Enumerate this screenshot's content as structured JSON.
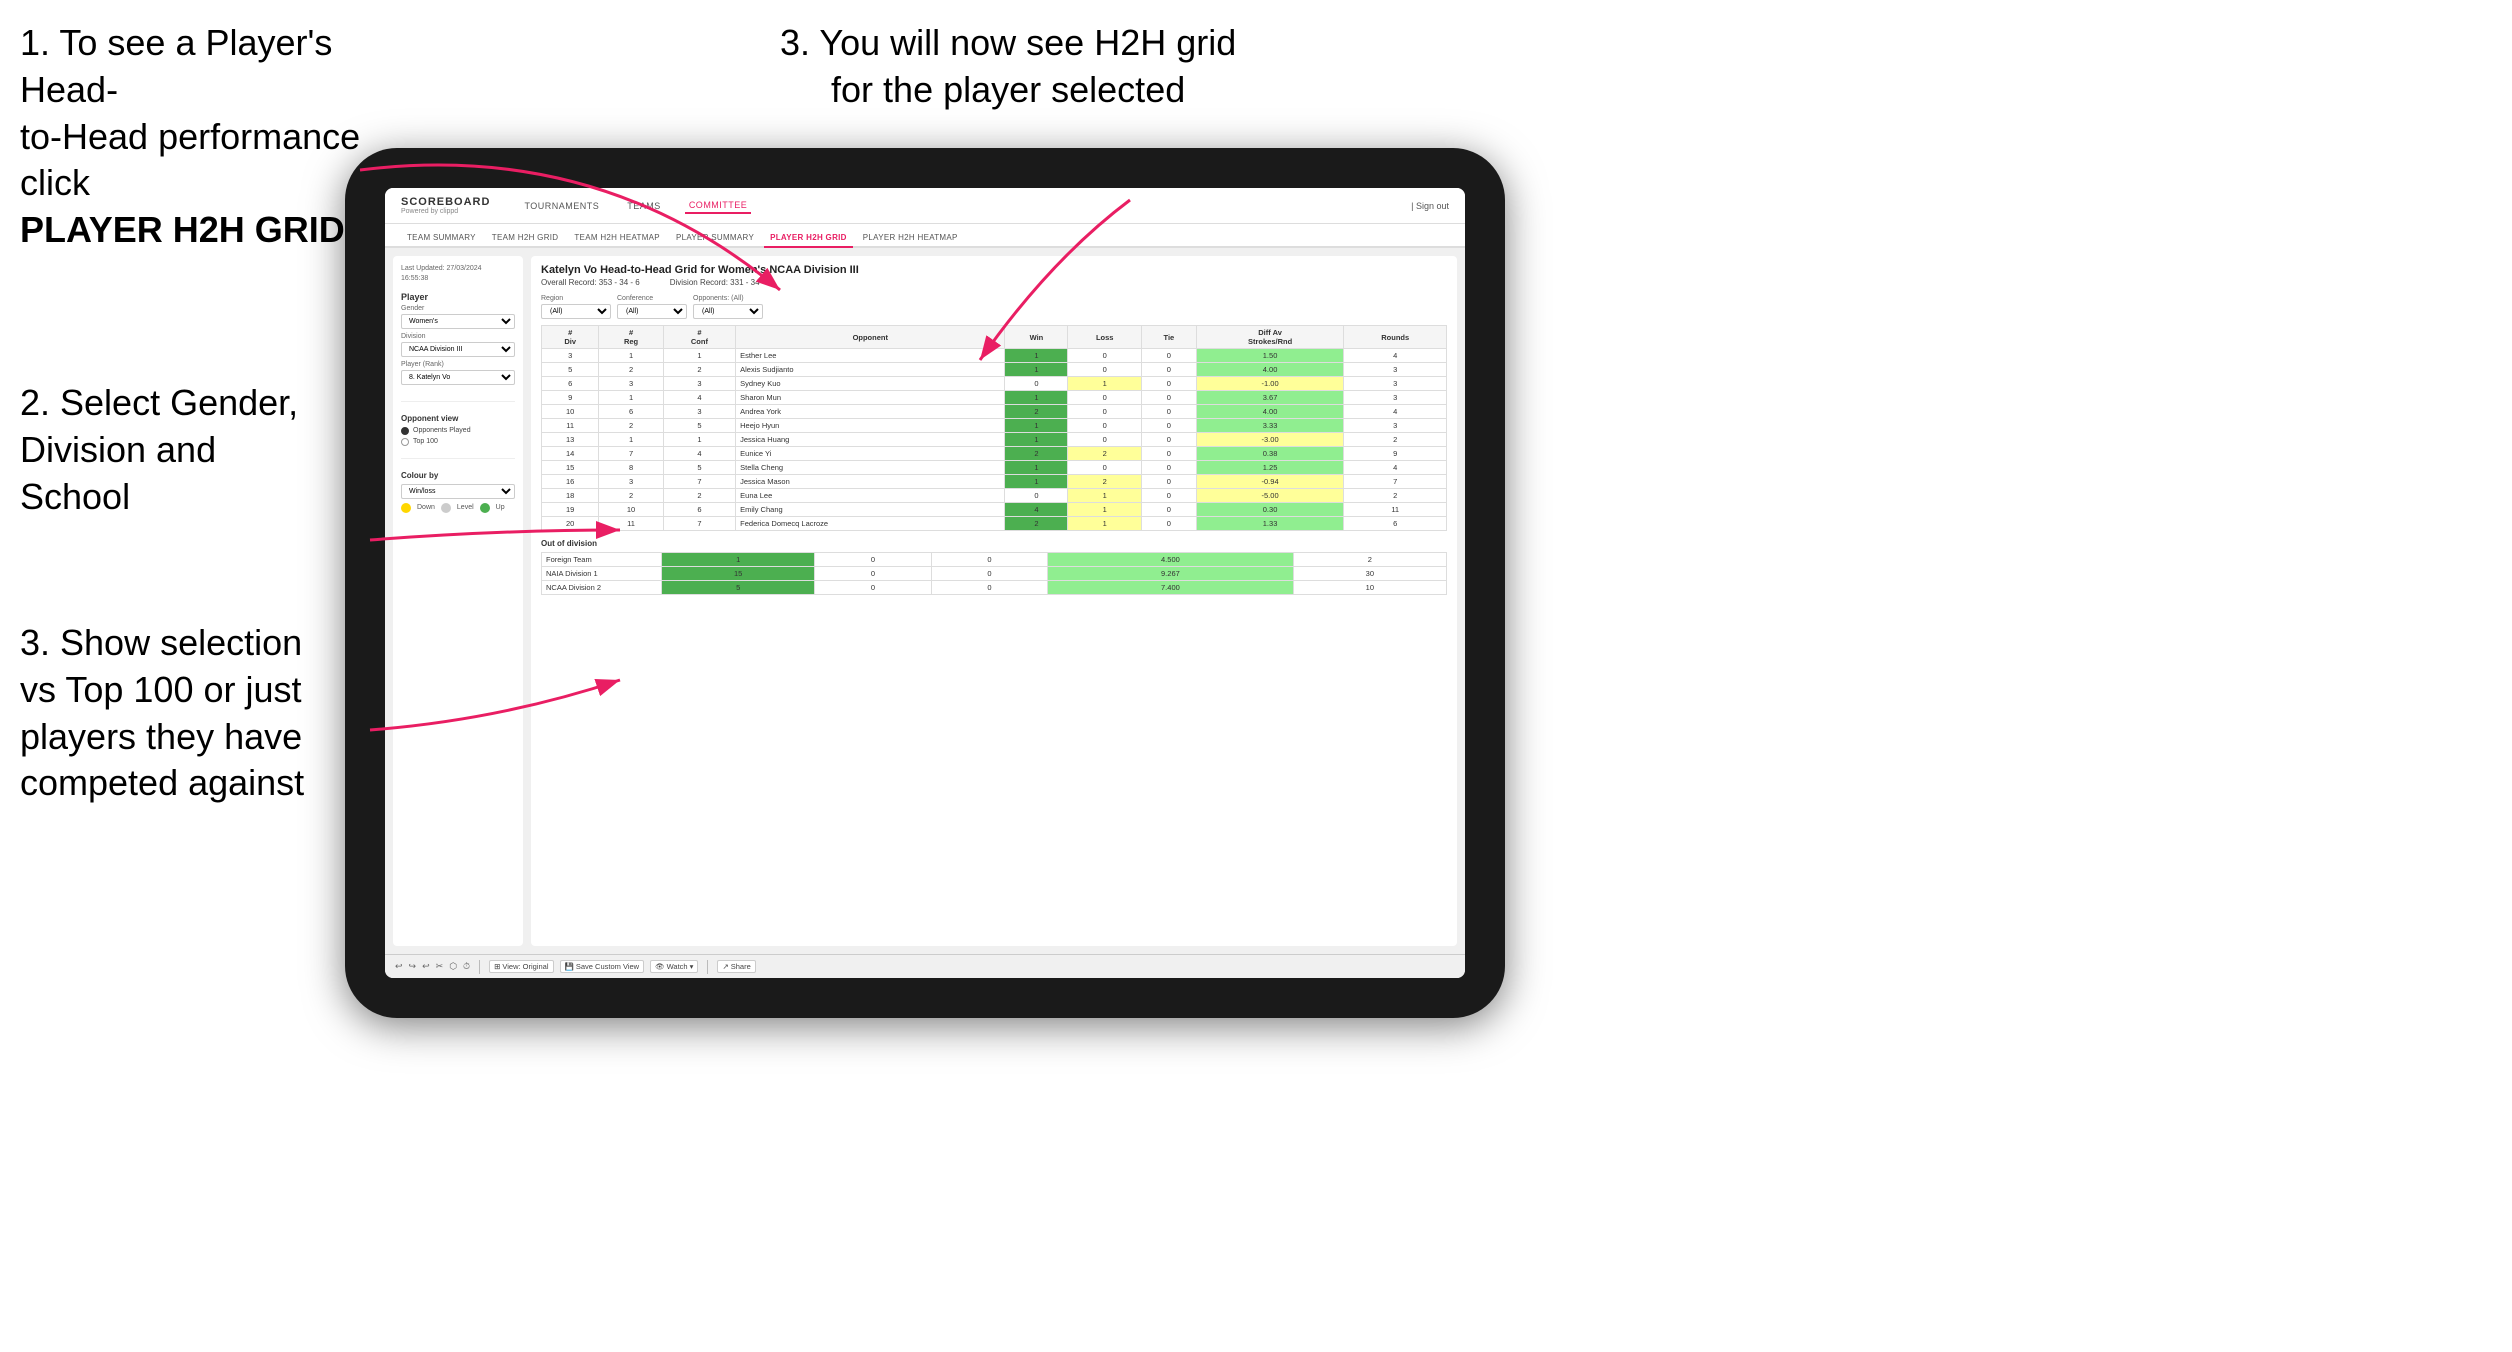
{
  "instructions": {
    "top_left_1": "1. To see a Player's Head-",
    "top_left_2": "to-Head performance click",
    "top_left_bold": "PLAYER H2H GRID",
    "top_right": "3. You will now see H2H grid\nfor the player selected",
    "mid_left_title": "2. Select Gender,\nDivision and\nSchool",
    "bot_left_title": "3. Show selection\nvs Top 100 or just\nplayers they have\ncompeted against"
  },
  "nav": {
    "logo": "SCOREBOARD",
    "logo_sub": "Powered by clippd",
    "items": [
      "TOURNAMENTS",
      "TEAMS",
      "COMMITTEE"
    ],
    "sign_out": "Sign out"
  },
  "sub_nav": {
    "items": [
      "TEAM SUMMARY",
      "TEAM H2H GRID",
      "TEAM H2H HEATMAP",
      "PLAYER SUMMARY",
      "PLAYER H2H GRID",
      "PLAYER H2H HEATMAP"
    ],
    "active": "PLAYER H2H GRID"
  },
  "sidebar": {
    "timestamp": "Last Updated: 27/03/2024\n16:55:38",
    "player_section": "Player",
    "gender_label": "Gender",
    "gender_value": "Women's",
    "division_label": "Division",
    "division_value": "NCAA Division III",
    "player_rank_label": "Player (Rank)",
    "player_rank_value": "8. Katelyn Vo",
    "opponent_view": "Opponent view",
    "opponent_options": [
      "Opponents Played",
      "Top 100"
    ],
    "opponent_selected": "Opponents Played",
    "colour_by": "Colour by",
    "colour_value": "Win/loss",
    "legend": [
      {
        "color": "#FFD700",
        "label": "Down"
      },
      {
        "color": "#cccccc",
        "label": "Level"
      },
      {
        "color": "#4CAF50",
        "label": "Up"
      }
    ]
  },
  "panel": {
    "title": "Katelyn Vo Head-to-Head Grid for Women's NCAA Division III",
    "overall_record": "Overall Record: 353 - 34 - 6",
    "division_record": "Division Record: 331 - 34 - 6",
    "filters": {
      "opponents_label": "Opponents:",
      "region_label": "Region",
      "conference_label": "Conference",
      "opponent_label": "Opponent",
      "all_value": "(All)"
    },
    "table_headers": [
      "# Div",
      "# Reg",
      "# Conf",
      "Opponent",
      "Win",
      "Loss",
      "Tie",
      "Diff Av Strokes/Rnd",
      "Rounds"
    ],
    "rows": [
      {
        "div": 3,
        "reg": 1,
        "conf": 1,
        "opponent": "Esther Lee",
        "win": 1,
        "loss": 0,
        "tie": 0,
        "diff": 1.5,
        "rounds": 4,
        "color": "green"
      },
      {
        "div": 5,
        "reg": 2,
        "conf": 2,
        "opponent": "Alexis Sudjianto",
        "win": 1,
        "loss": 0,
        "tie": 0,
        "diff": 4.0,
        "rounds": 3,
        "color": "green"
      },
      {
        "div": 6,
        "reg": 3,
        "conf": 3,
        "opponent": "Sydney Kuo",
        "win": 0,
        "loss": 1,
        "tie": 0,
        "diff": -1.0,
        "rounds": 3,
        "color": "yellow"
      },
      {
        "div": 9,
        "reg": 1,
        "conf": 4,
        "opponent": "Sharon Mun",
        "win": 1,
        "loss": 0,
        "tie": 0,
        "diff": 3.67,
        "rounds": 3,
        "color": "green"
      },
      {
        "div": 10,
        "reg": 6,
        "conf": 3,
        "opponent": "Andrea York",
        "win": 2,
        "loss": 0,
        "tie": 0,
        "diff": 4.0,
        "rounds": 4,
        "color": "green"
      },
      {
        "div": 11,
        "reg": 2,
        "conf": 5,
        "opponent": "Heejo Hyun",
        "win": 1,
        "loss": 0,
        "tie": 0,
        "diff": 3.33,
        "rounds": 3,
        "color": "green"
      },
      {
        "div": 13,
        "reg": 1,
        "conf": 1,
        "opponent": "Jessica Huang",
        "win": 1,
        "loss": 0,
        "tie": 0,
        "diff": -3.0,
        "rounds": 2,
        "color": "yellow"
      },
      {
        "div": 14,
        "reg": 7,
        "conf": 4,
        "opponent": "Eunice Yi",
        "win": 2,
        "loss": 2,
        "tie": 0,
        "diff": 0.38,
        "rounds": 9,
        "color": "light-green"
      },
      {
        "div": 15,
        "reg": 8,
        "conf": 5,
        "opponent": "Stella Cheng",
        "win": 1,
        "loss": 0,
        "tie": 0,
        "diff": 1.25,
        "rounds": 4,
        "color": "green"
      },
      {
        "div": 16,
        "reg": 3,
        "conf": 7,
        "opponent": "Jessica Mason",
        "win": 1,
        "loss": 2,
        "tie": 0,
        "diff": -0.94,
        "rounds": 7,
        "color": "yellow"
      },
      {
        "div": 18,
        "reg": 2,
        "conf": 2,
        "opponent": "Euna Lee",
        "win": 0,
        "loss": 1,
        "tie": 0,
        "diff": -5.0,
        "rounds": 2,
        "color": "yellow"
      },
      {
        "div": 19,
        "reg": 10,
        "conf": 6,
        "opponent": "Emily Chang",
        "win": 4,
        "loss": 1,
        "tie": 0,
        "diff": 0.3,
        "rounds": 11,
        "color": "light-green"
      },
      {
        "div": 20,
        "reg": 11,
        "conf": 7,
        "opponent": "Federica Domecq Lacroze",
        "win": 2,
        "loss": 1,
        "tie": 0,
        "diff": 1.33,
        "rounds": 6,
        "color": "light-green"
      }
    ],
    "out_of_division": "Out of division",
    "ood_rows": [
      {
        "label": "Foreign Team",
        "win": 1,
        "loss": 0,
        "tie": 0,
        "diff": 4.5,
        "rounds": 2
      },
      {
        "label": "NAIA Division 1",
        "win": 15,
        "loss": 0,
        "tie": 0,
        "diff": 9.267,
        "rounds": 30
      },
      {
        "label": "NCAA Division 2",
        "win": 5,
        "loss": 0,
        "tie": 0,
        "diff": 7.4,
        "rounds": 10
      }
    ]
  },
  "toolbar": {
    "buttons": [
      "View: Original",
      "Save Custom View",
      "Watch",
      "Share"
    ]
  },
  "colors": {
    "active_nav": "#e91e63",
    "green": "#4CAF50",
    "light_green": "#90EE90",
    "yellow": "#FFFF99",
    "gold": "#FFD700"
  }
}
